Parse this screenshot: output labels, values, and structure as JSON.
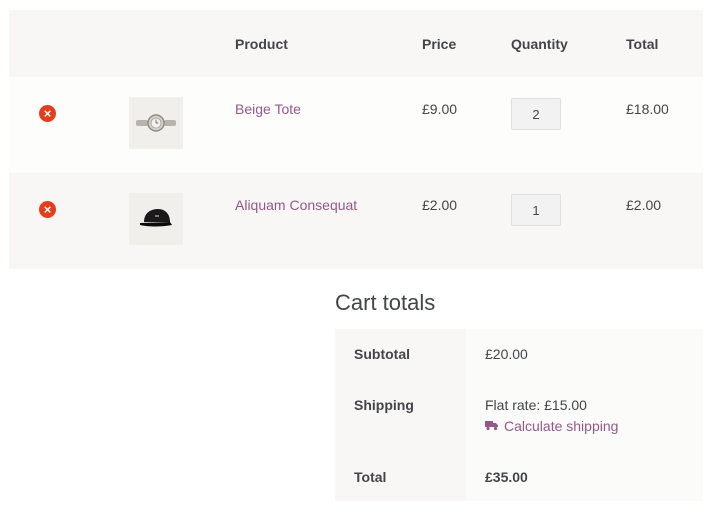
{
  "cart": {
    "headers": {
      "product": "Product",
      "price": "Price",
      "quantity": "Quantity",
      "total": "Total"
    },
    "items": [
      {
        "name": "Beige Tote",
        "price": "£9.00",
        "quantity": "2",
        "total": "£18.00",
        "thumbnail_icon": "watch-icon"
      },
      {
        "name": "Aliquam Consequat",
        "price": "£2.00",
        "quantity": "1",
        "total": "£2.00",
        "thumbnail_icon": "cap-icon"
      }
    ],
    "remove_icon": "remove-icon",
    "remove_color": "#e2401c"
  },
  "totals": {
    "title": "Cart totals",
    "subtotal_label": "Subtotal",
    "subtotal_value": "£20.00",
    "shipping_label": "Shipping",
    "shipping_value": "Flat rate: £15.00",
    "calculate_shipping": "Calculate shipping",
    "shipping_icon": "truck-icon",
    "total_label": "Total",
    "total_value": "£35.00"
  },
  "colors": {
    "link": "#96588a",
    "text": "#43454b",
    "row_bg": "#f8f7f5"
  }
}
